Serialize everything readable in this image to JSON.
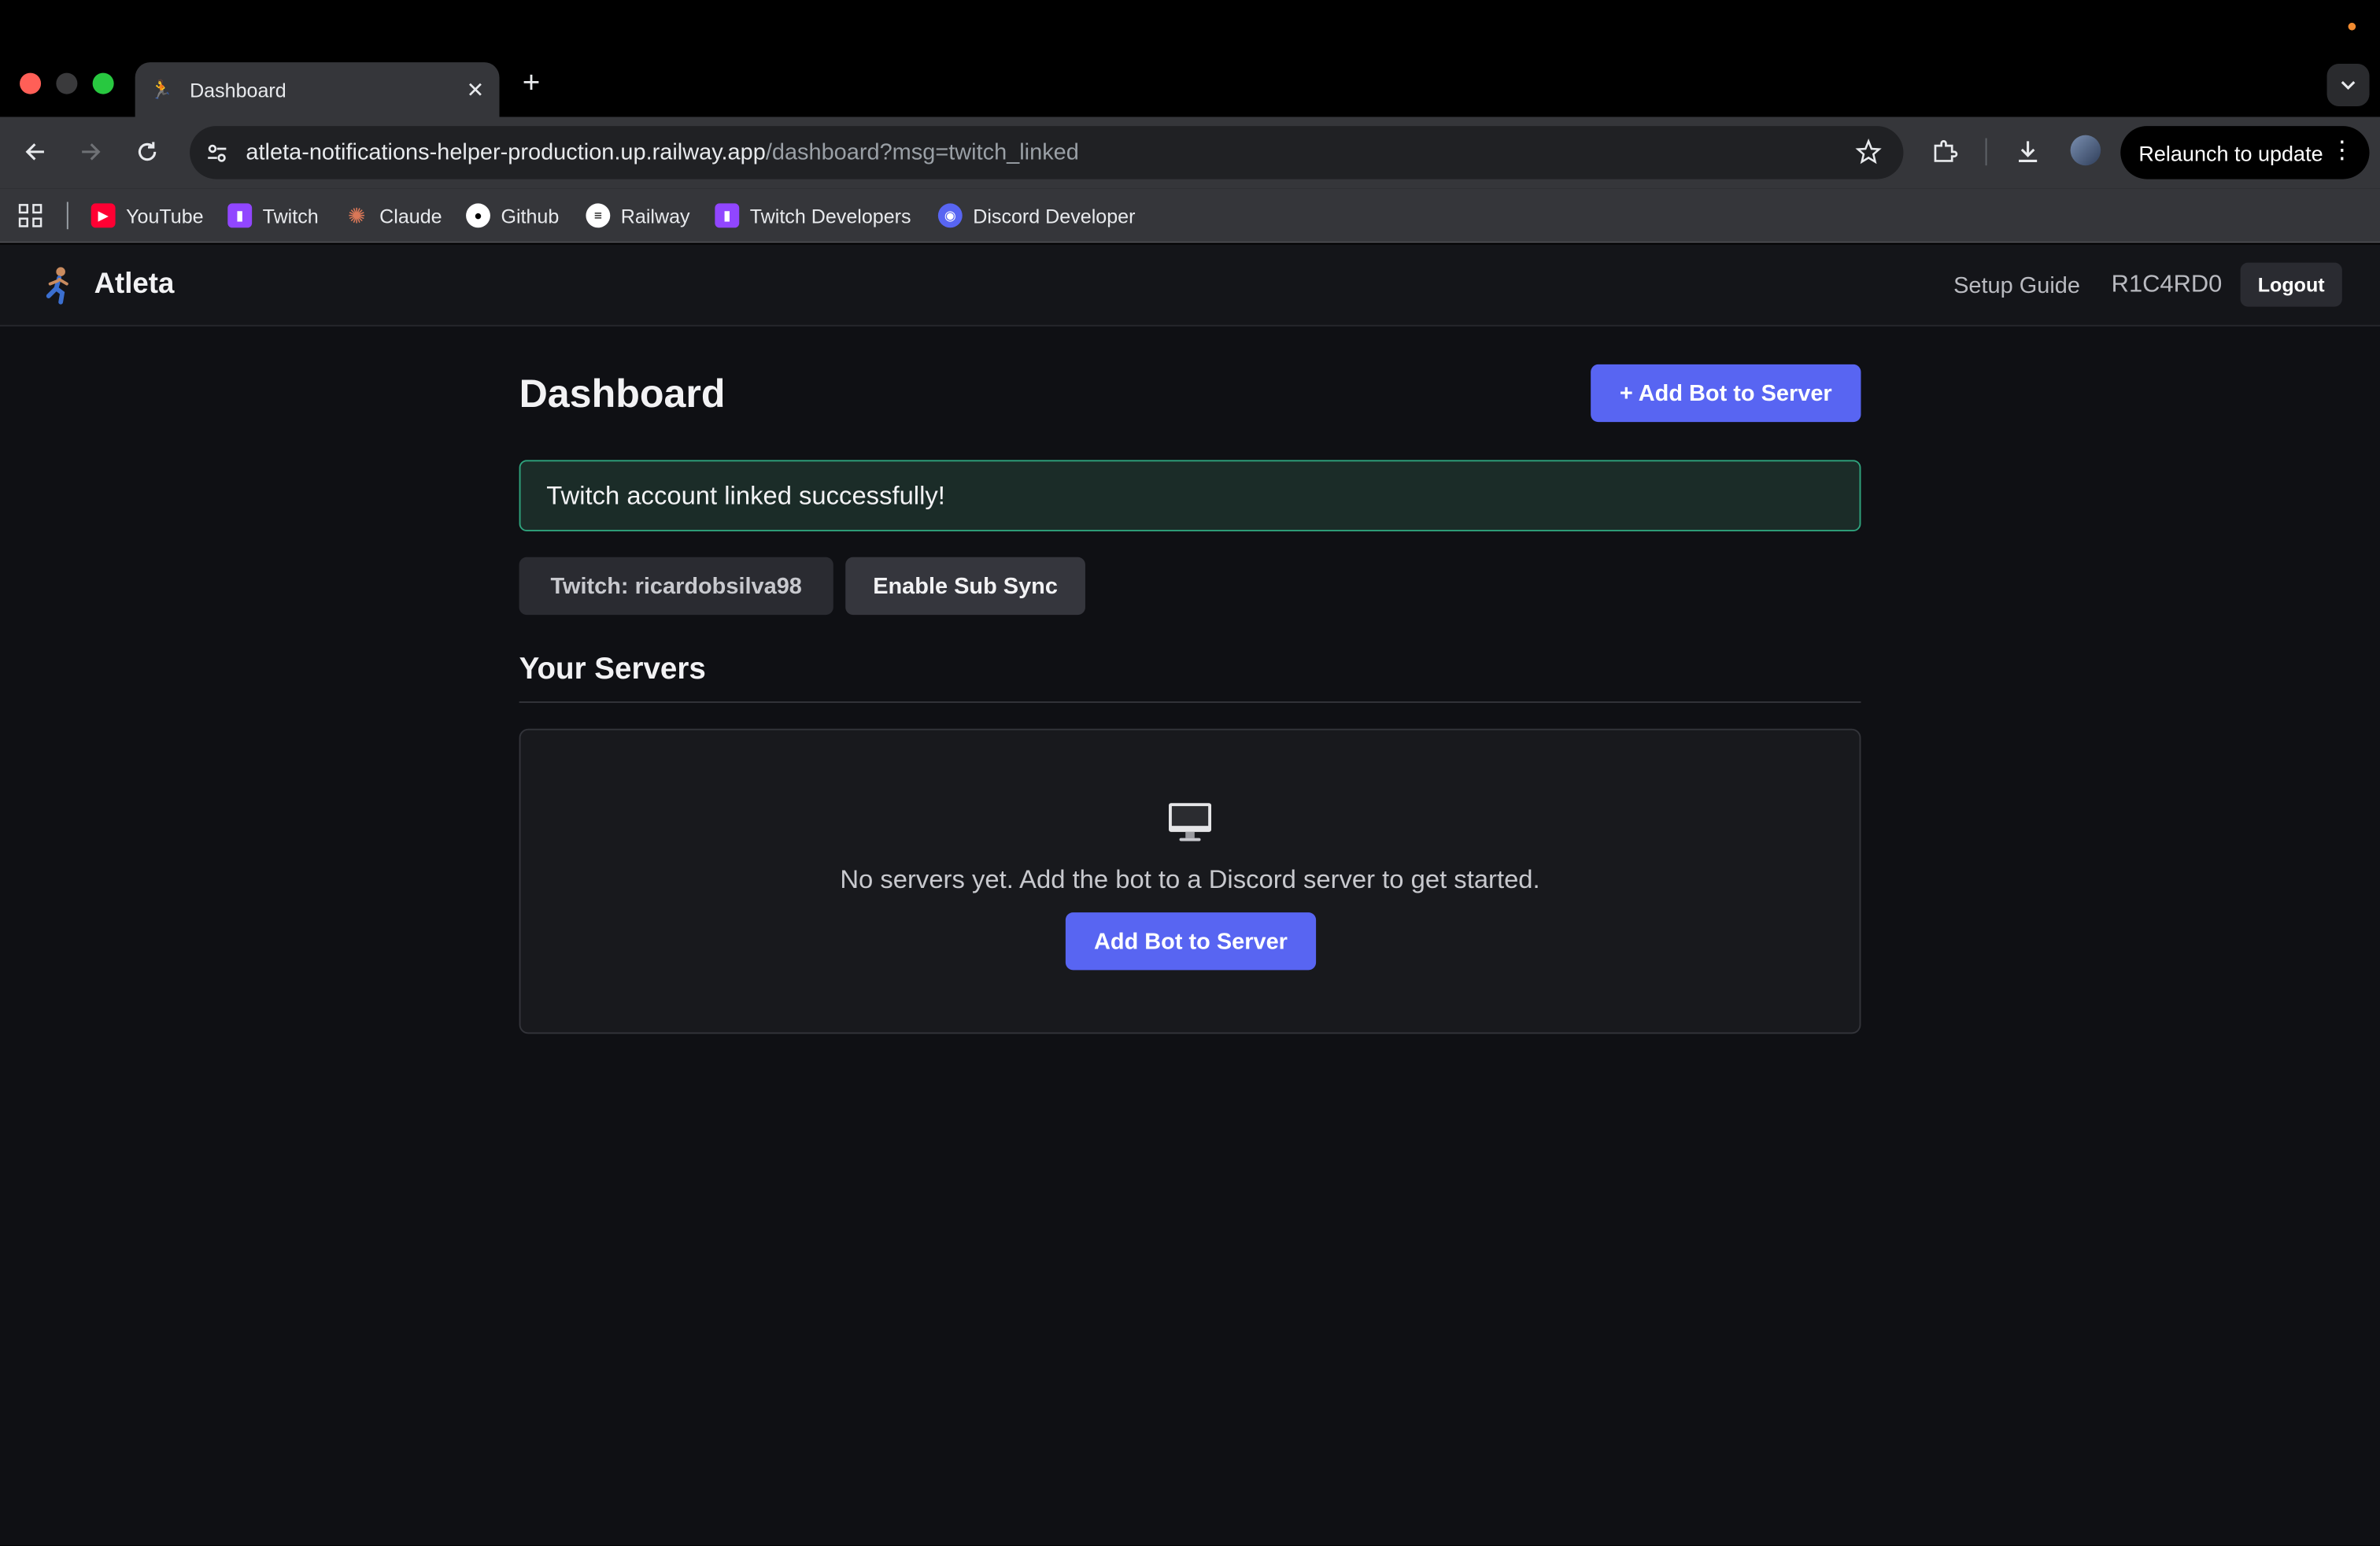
{
  "browser": {
    "tab_title": "Dashboard",
    "url_host": "atleta-notifications-helper-production.up.railway.app",
    "url_path": "/dashboard?msg=twitch_linked",
    "relaunch_label": "Relaunch to update",
    "bookmarks": [
      {
        "label": "YouTube",
        "icon": "youtube-icon",
        "color": "#ff0033"
      },
      {
        "label": "Twitch",
        "icon": "twitch-icon",
        "color": "#9146ff"
      },
      {
        "label": "Claude",
        "icon": "claude-icon",
        "color": "#d97757"
      },
      {
        "label": "Github",
        "icon": "github-icon",
        "color": "#ffffff"
      },
      {
        "label": "Railway",
        "icon": "railway-icon",
        "color": "#ffffff"
      },
      {
        "label": "Twitch Developers",
        "icon": "twitch-icon",
        "color": "#9146ff"
      },
      {
        "label": "Discord Developer",
        "icon": "discord-icon",
        "color": "#5865f2"
      }
    ]
  },
  "header": {
    "brand": "Atleta",
    "setup_guide": "Setup Guide",
    "username": "R1C4RD0",
    "logout": "Logout"
  },
  "main": {
    "title": "Dashboard",
    "add_bot_button": "+ Add Bot to Server",
    "alert": "Twitch account linked successfully!",
    "twitch_chip": "Twitch: ricardobsilva98",
    "sub_sync_button": "Enable Sub Sync",
    "servers_heading": "Your Servers",
    "empty_icon": "monitor-icon",
    "empty_text": "No servers yet. Add the bot to a Discord server to get started.",
    "empty_add_button": "Add Bot to Server"
  },
  "colors": {
    "accent": "#5865f2",
    "success_border": "#2fa37d",
    "background": "#0f1014"
  }
}
